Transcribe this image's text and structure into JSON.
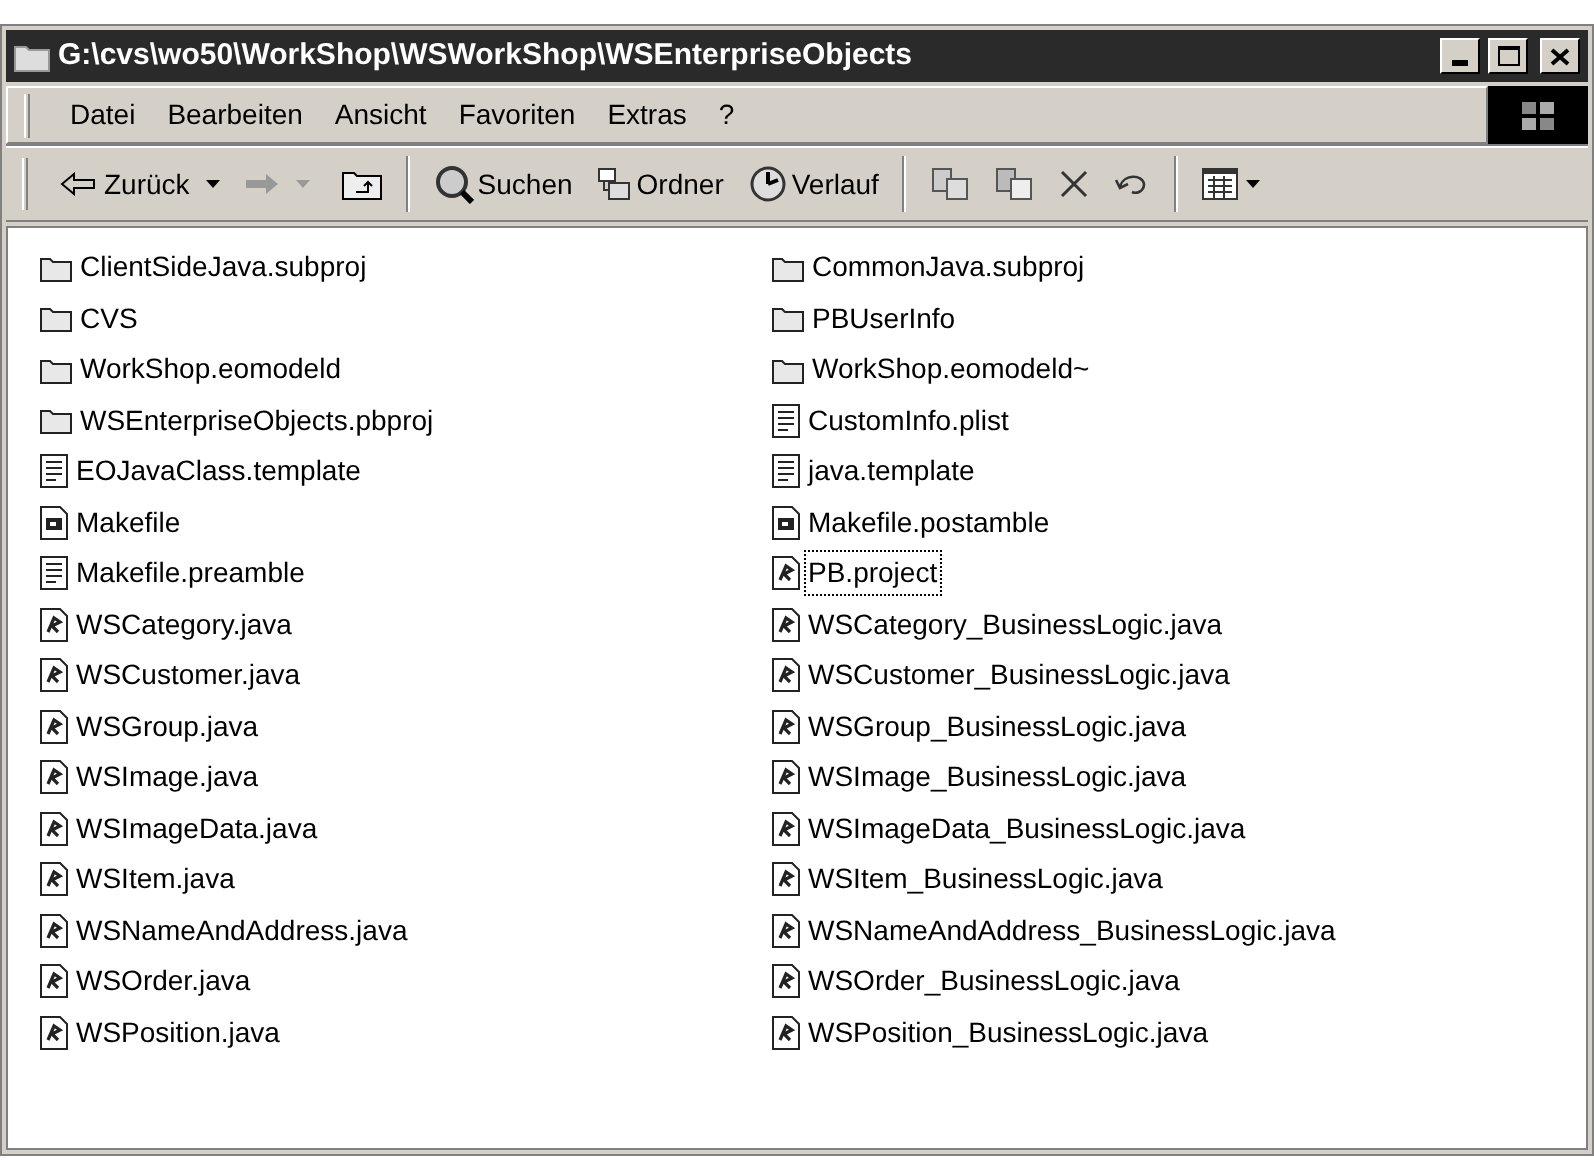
{
  "window": {
    "title": "G:\\cvs\\wo50\\WorkShop\\WSWorkShop\\WSEnterpriseObjects"
  },
  "menu": [
    "Datei",
    "Bearbeiten",
    "Ansicht",
    "Favoriten",
    "Extras",
    "?"
  ],
  "toolbar": {
    "back": {
      "label": "Zurück"
    },
    "forward": {
      "disabled": true
    },
    "search": {
      "label": "Suchen"
    },
    "folders": {
      "label": "Ordner"
    },
    "history": {
      "label": "Verlauf"
    }
  },
  "files": [
    {
      "name": "ClientSideJava.subproj",
      "kind": "folder",
      "focused": false
    },
    {
      "name": "CVS",
      "kind": "folder",
      "focused": false
    },
    {
      "name": "WorkShop.eomodeld",
      "kind": "folder",
      "focused": false
    },
    {
      "name": "WSEnterpriseObjects.pbproj",
      "kind": "folder",
      "focused": false
    },
    {
      "name": "EOJavaClass.template",
      "kind": "text",
      "focused": false
    },
    {
      "name": "Makefile",
      "kind": "makefile",
      "focused": false
    },
    {
      "name": "Makefile.preamble",
      "kind": "text",
      "focused": false
    },
    {
      "name": "WSCategory.java",
      "kind": "java",
      "focused": false
    },
    {
      "name": "WSCustomer.java",
      "kind": "java",
      "focused": false
    },
    {
      "name": "WSGroup.java",
      "kind": "java",
      "focused": false
    },
    {
      "name": "WSImage.java",
      "kind": "java",
      "focused": false
    },
    {
      "name": "WSImageData.java",
      "kind": "java",
      "focused": false
    },
    {
      "name": "WSItem.java",
      "kind": "java",
      "focused": false
    },
    {
      "name": "WSNameAndAddress.java",
      "kind": "java",
      "focused": false
    },
    {
      "name": "WSOrder.java",
      "kind": "java",
      "focused": false
    },
    {
      "name": "WSPosition.java",
      "kind": "java",
      "focused": false
    },
    {
      "name": "CommonJava.subproj",
      "kind": "folder",
      "focused": false
    },
    {
      "name": "PBUserInfo",
      "kind": "folder",
      "focused": false
    },
    {
      "name": "WorkShop.eomodeld~",
      "kind": "folder",
      "focused": false
    },
    {
      "name": "CustomInfo.plist",
      "kind": "text",
      "focused": false
    },
    {
      "name": "java.template",
      "kind": "text",
      "focused": false
    },
    {
      "name": "Makefile.postamble",
      "kind": "makefile",
      "focused": false
    },
    {
      "name": "PB.project",
      "kind": "java",
      "focused": true
    },
    {
      "name": "WSCategory_BusinessLogic.java",
      "kind": "java",
      "focused": false
    },
    {
      "name": "WSCustomer_BusinessLogic.java",
      "kind": "java",
      "focused": false
    },
    {
      "name": "WSGroup_BusinessLogic.java",
      "kind": "java",
      "focused": false
    },
    {
      "name": "WSImage_BusinessLogic.java",
      "kind": "java",
      "focused": false
    },
    {
      "name": "WSImageData_BusinessLogic.java",
      "kind": "java",
      "focused": false
    },
    {
      "name": "WSItem_BusinessLogic.java",
      "kind": "java",
      "focused": false
    },
    {
      "name": "WSNameAndAddress_BusinessLogic.java",
      "kind": "java",
      "focused": false
    },
    {
      "name": "WSOrder_BusinessLogic.java",
      "kind": "java",
      "focused": false
    },
    {
      "name": "WSPosition_BusinessLogic.java",
      "kind": "java",
      "focused": false
    }
  ]
}
